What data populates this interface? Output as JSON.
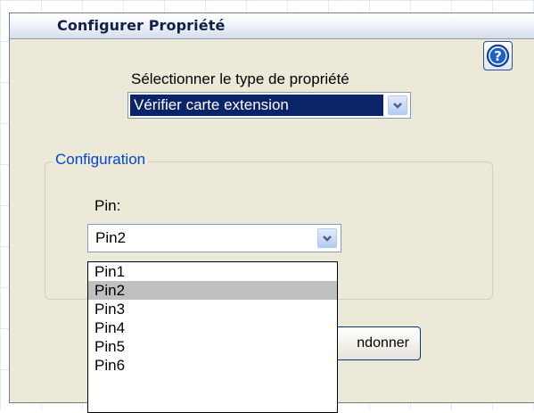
{
  "dialog": {
    "title": "Configurer Propriété",
    "help_icon": "help-icon"
  },
  "property_type": {
    "label": "Sélectionner le type de propriété",
    "selected": "Vérifier carte extension",
    "dropdown_icon": "chevron-down-icon"
  },
  "configuration": {
    "group_label": "Configuration",
    "pin_label": "Pin:",
    "pin_selected": "Pin2",
    "pin_options": [
      "Pin1",
      "Pin2",
      "Pin3",
      "Pin4",
      "Pin5",
      "Pin6"
    ],
    "highlighted_index": 1
  },
  "buttons": {
    "abandon_label": "ndonner"
  },
  "colors": {
    "dialog_background": "#ece9d8",
    "selection_highlight": "#0a246a",
    "group_label_color": "#0046d5",
    "list_highlight": "#c0c0c0"
  }
}
